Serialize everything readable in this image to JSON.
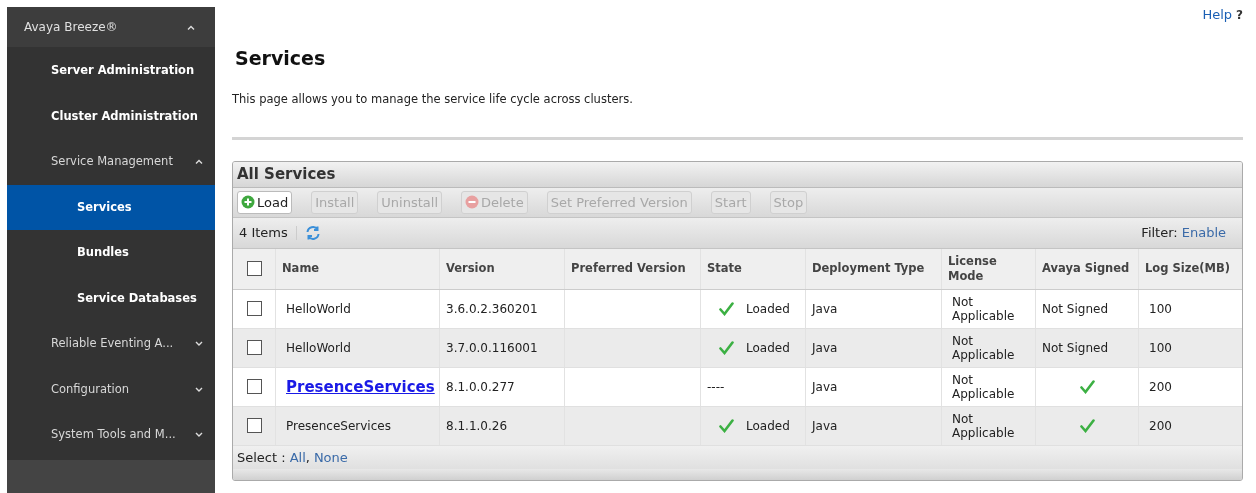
{
  "sidebar": {
    "title": "Avaya Breeze®",
    "expanded": true,
    "items": [
      {
        "label": "Server Administration",
        "selected": false
      },
      {
        "label": "Cluster Administration",
        "selected": false
      },
      {
        "label": "Service Management",
        "expanded": true,
        "selected": false,
        "children": [
          {
            "label": "Services",
            "selected": true
          },
          {
            "label": "Bundles",
            "selected": false
          },
          {
            "label": "Service Databases",
            "selected": false
          }
        ]
      },
      {
        "label": "Reliable Eventing A...",
        "expanded": false,
        "selected": false
      },
      {
        "label": "Configuration",
        "expanded": false,
        "selected": false
      },
      {
        "label": "System Tools and M...",
        "expanded": false,
        "selected": false
      }
    ]
  },
  "help": "Help",
  "help_mark": "?",
  "page": {
    "title": "Services",
    "description": "This page allows you to manage the service life cycle across clusters."
  },
  "panel": {
    "title": "All Services",
    "toolbar": [
      {
        "label": "Load",
        "disabled": false,
        "kind": "add"
      },
      {
        "label": "Install",
        "disabled": true
      },
      {
        "label": "Uninstall",
        "disabled": true
      },
      {
        "label": "Delete",
        "disabled": true,
        "kind": "remove"
      },
      {
        "label": "Set Preferred Version",
        "disabled": true
      },
      {
        "label": "Start",
        "disabled": true
      },
      {
        "label": "Stop",
        "disabled": true
      }
    ],
    "count": "4 Items",
    "filter_label": "Filter:",
    "filter_link": "Enable",
    "columns": [
      "Name",
      "Version",
      "Preferred Version",
      "State",
      "Deployment Type",
      "License Mode",
      "Avaya Signed",
      "Log Size(MB)"
    ],
    "select_all_checked": false,
    "rows": [
      {
        "checked": false,
        "name": "HelloWorld",
        "link": false,
        "version": "3.6.0.2.360201",
        "state": {
          "kind": "loaded",
          "text": "Loaded"
        },
        "deployment": "Java",
        "license": "Not Applicable",
        "signed": {
          "kind": "text",
          "text": "Not Signed"
        },
        "log_size": "100"
      },
      {
        "checked": false,
        "name": "HelloWorld",
        "link": false,
        "version": "3.7.0.0.116001",
        "state": {
          "kind": "loaded",
          "text": "Loaded"
        },
        "deployment": "Java",
        "license": "Not Applicable",
        "signed": {
          "kind": "text",
          "text": "Not Signed"
        },
        "log_size": "100"
      },
      {
        "checked": false,
        "name": "PresenceServices",
        "link": true,
        "version": "8.1.0.0.277",
        "state": {
          "kind": "text",
          "text": "----"
        },
        "deployment": "Java",
        "license": "Not Applicable",
        "signed": {
          "kind": "check"
        },
        "log_size": "200"
      },
      {
        "checked": false,
        "name": "PresenceServices",
        "link": false,
        "version": "8.1.1.0.26",
        "state": {
          "kind": "loaded",
          "text": "Loaded"
        },
        "deployment": "Java",
        "license": "Not Applicable",
        "signed": {
          "kind": "check"
        },
        "log_size": "200"
      }
    ],
    "select_label": "Select :",
    "select_links": [
      "All",
      "None"
    ],
    "select_separator": ","
  }
}
